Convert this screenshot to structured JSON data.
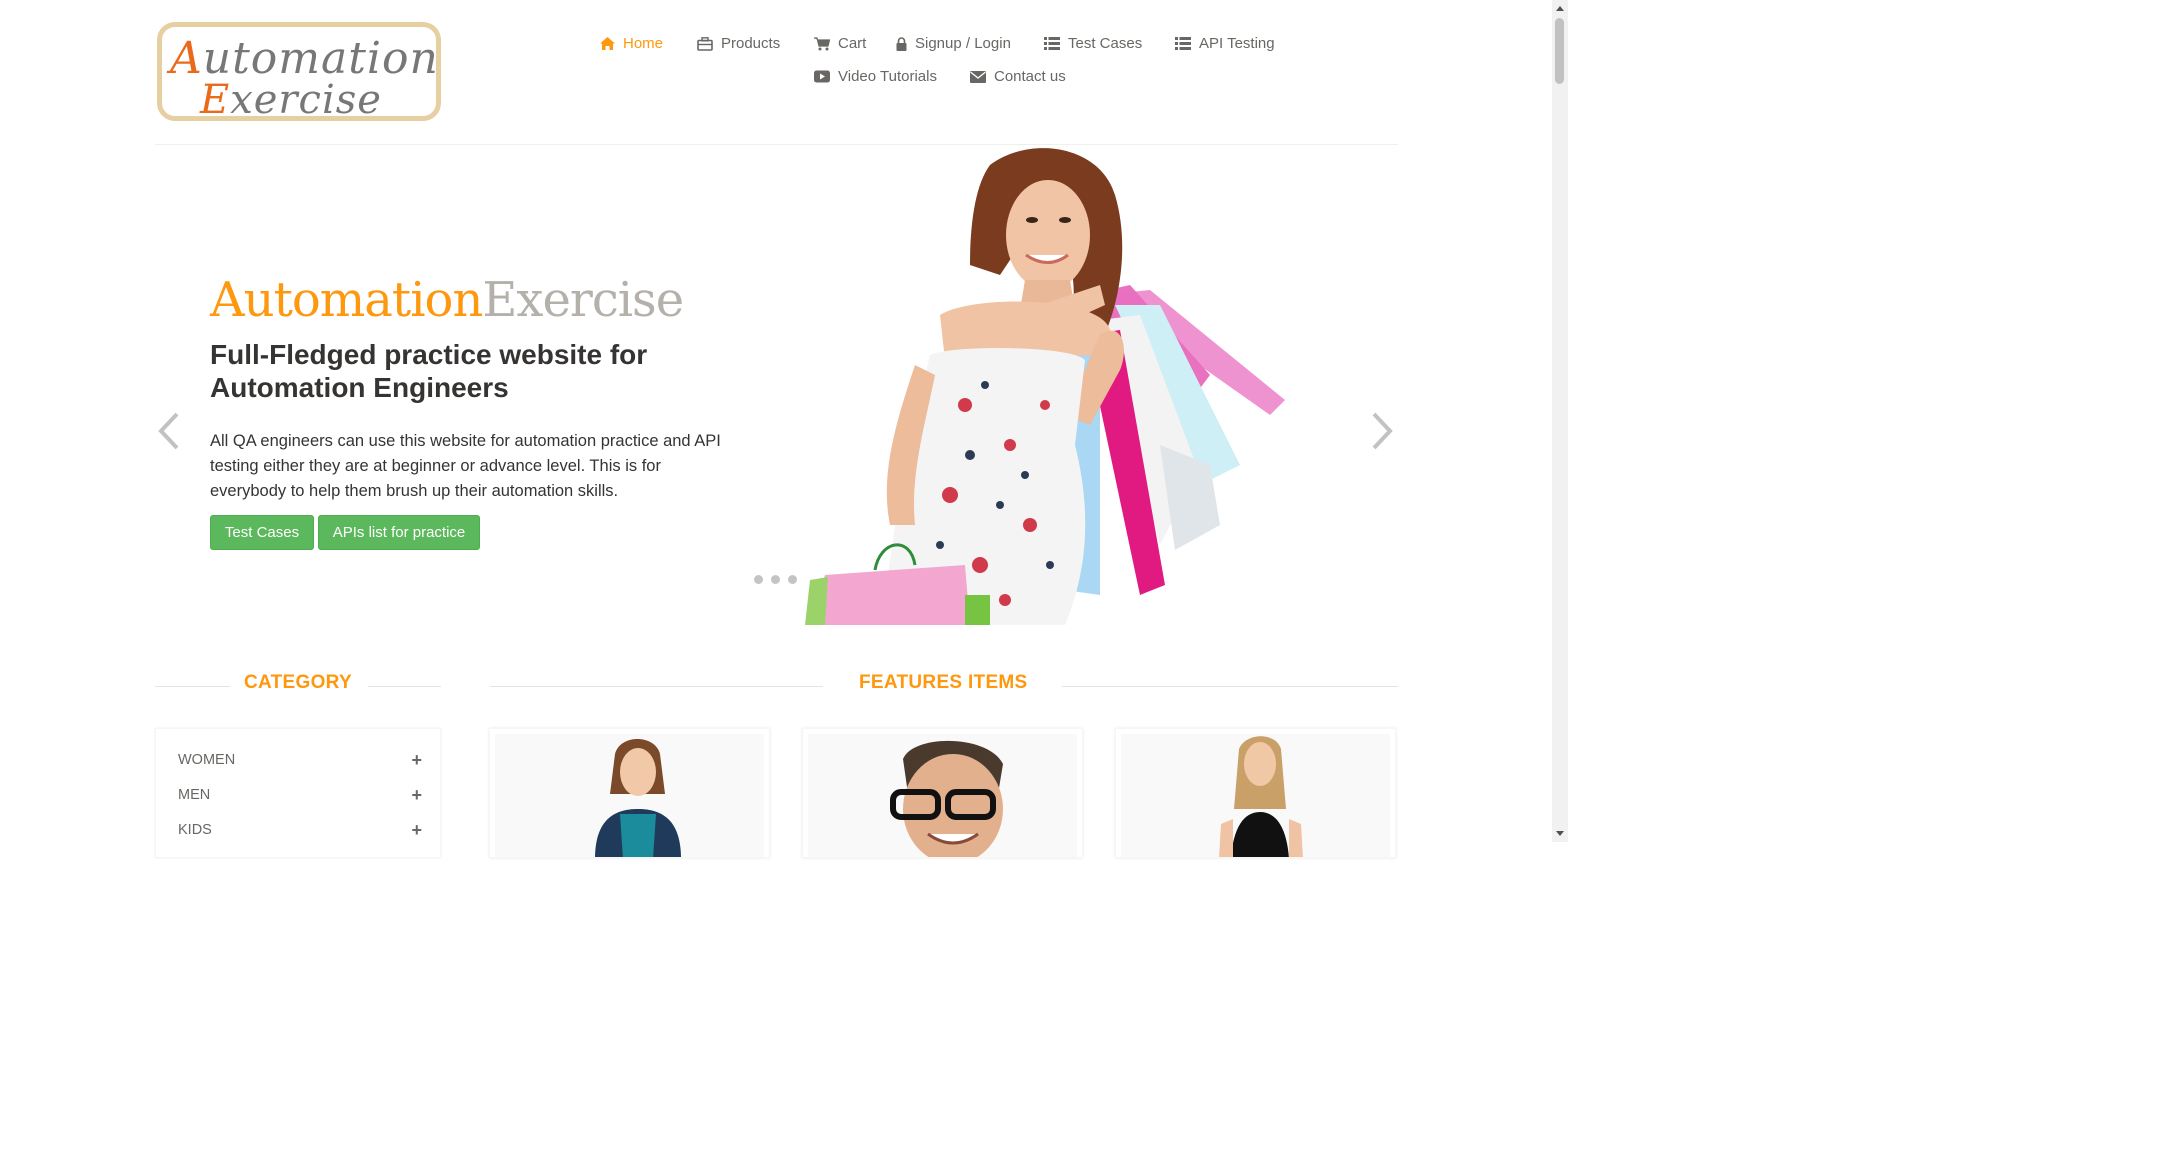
{
  "header": {
    "logo": {
      "line1": "Automation",
      "line2": "Exercise"
    },
    "nav": [
      {
        "label": "Home",
        "icon": "home-icon",
        "active": true
      },
      {
        "label": "Products",
        "icon": "briefcase-icon"
      },
      {
        "label": "Cart",
        "icon": "cart-icon"
      },
      {
        "label": "Signup / Login",
        "icon": "lock-icon"
      },
      {
        "label": "Test Cases",
        "icon": "list-icon"
      },
      {
        "label": "API Testing",
        "icon": "list-icon"
      },
      {
        "label": "Video Tutorials",
        "icon": "youtube-play-icon"
      },
      {
        "label": "Contact us",
        "icon": "envelope-icon"
      }
    ]
  },
  "slider": {
    "brand_part1": "Automation",
    "brand_part2": "Exercise",
    "headline": "Full-Fledged practice website for Automation Engineers",
    "description": "All QA engineers can use this website for automation practice and API testing either they are at beginner or advance level. This is for everybody to help them brush up their automation skills.",
    "buttons": [
      "Test Cases",
      "APIs list for practice"
    ],
    "slide_count": 3
  },
  "sidebar": {
    "title": "CATEGORY",
    "categories": [
      "WOMEN",
      "MEN",
      "KIDS"
    ]
  },
  "main": {
    "title": "FEATURES ITEMS"
  },
  "colors": {
    "accent": "#fe980f",
    "button_green": "#5cb85c",
    "text": "#696763",
    "brand_grey": "#b4b1ab"
  }
}
